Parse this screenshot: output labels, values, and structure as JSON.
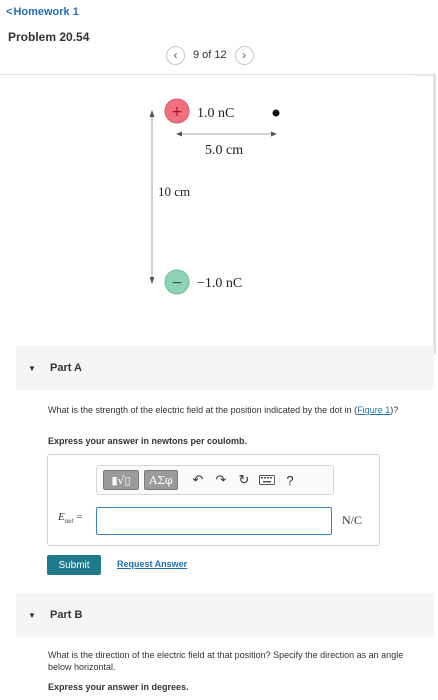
{
  "nav": {
    "back_label": "Homework 1"
  },
  "problem": {
    "title": "Problem 20.54"
  },
  "pager": {
    "text": "9 of 12"
  },
  "figure": {
    "positive_charge": {
      "sign": "+",
      "label": "1.0 nC",
      "color": "#f07080"
    },
    "negative_charge": {
      "sign": "−",
      "label": "−1.0 nC",
      "color": "#8fd3b5"
    },
    "horizontal_distance": "5.0 cm",
    "vertical_distance": "10 cm"
  },
  "part_a": {
    "label": "Part A",
    "question": "What is the strength of the electric field at the position indicated by the dot in (",
    "figure_link": "Figure 1",
    "question_end": ")?",
    "instruction": "Express your answer in newtons per coulomb.",
    "toolbar": {
      "templates_label": "▮√▯",
      "greek_label": "ΑΣφ",
      "help_label": "?"
    },
    "variable": "E",
    "variable_sub": "net",
    "equals": "=",
    "input_value": "",
    "unit": "N/C",
    "submit_label": "Submit",
    "request_label": "Request Answer"
  },
  "part_b": {
    "label": "Part B",
    "question": "What is the direction of the electric field at that position? Specify the direction as an angle below horizontal.",
    "instruction": "Express your answer in degrees."
  },
  "colors": {
    "accent": "#1f6fb2",
    "submit": "#1f7a8c",
    "input_border": "#3a82c4"
  }
}
